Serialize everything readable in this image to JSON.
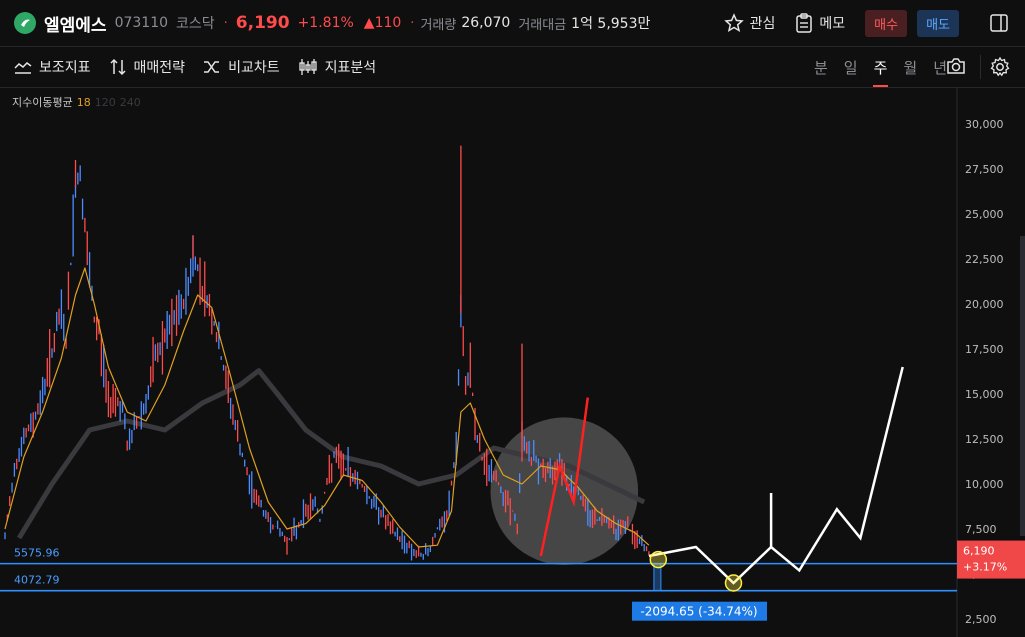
{
  "header": {
    "name": "엘엠에스",
    "code": "073110",
    "market": "코스닥",
    "price": "6,190",
    "change_pct": "+1.81%",
    "change_amt": "▲110",
    "volume_label": "거래량",
    "volume": "26,070",
    "turnover_label": "거래대금",
    "turnover": "1억 5,953만",
    "watch_label": "관심",
    "memo_label": "메모",
    "buy_label": "매수",
    "sell_label": "매도"
  },
  "toolbar": {
    "indicators_label": "보조지표",
    "strategy_label": "매매전략",
    "compare_label": "비교차트",
    "analysis_label": "지표분석",
    "periods": [
      "분",
      "일",
      "주",
      "월",
      "년"
    ],
    "active_period": "주"
  },
  "legend": {
    "title": "지수이동평균",
    "ma1": "18",
    "ma2": "120",
    "ma3": "240"
  },
  "colors": {
    "up": "#ff4b4b",
    "down": "#4b8cff",
    "ma18": "#e0a020",
    "ma_long": "#3a3a3e",
    "level_line": "#2f8fff",
    "projection": "#ffffff",
    "pattern": "#ff2020",
    "marker": "#ffee44"
  },
  "chart_data": {
    "type": "line",
    "y_axis": {
      "ticks": [
        "30,000",
        "27,500",
        "25,000",
        "22,500",
        "20,000",
        "17,500",
        "15,000",
        "12,500",
        "10,000",
        "7,500",
        "5,000",
        "2,500"
      ],
      "tick_values": [
        30000,
        27500,
        25000,
        22500,
        20000,
        17500,
        15000,
        12500,
        10000,
        7500,
        5000,
        2500
      ],
      "ylim": [
        1500,
        32000
      ]
    },
    "x_range": [
      0,
      100
    ],
    "grid": false,
    "price_series": [
      [
        0,
        7000
      ],
      [
        2,
        11000
      ],
      [
        4,
        12500
      ],
      [
        6,
        13500
      ],
      [
        8,
        15000
      ],
      [
        10,
        17500
      ],
      [
        12,
        19500
      ],
      [
        13,
        18000
      ],
      [
        15,
        26500
      ],
      [
        16,
        27300
      ],
      [
        17,
        24000
      ],
      [
        18,
        21500
      ],
      [
        19,
        19000
      ],
      [
        20,
        18500
      ],
      [
        21,
        16500
      ],
      [
        22,
        14500
      ],
      [
        23,
        15000
      ],
      [
        25,
        14200
      ],
      [
        26,
        12000
      ],
      [
        28,
        13500
      ],
      [
        30,
        14500
      ],
      [
        32,
        17000
      ],
      [
        34,
        18000
      ],
      [
        36,
        19000
      ],
      [
        38,
        20000
      ],
      [
        40,
        22500
      ],
      [
        41,
        22000
      ],
      [
        42,
        21000
      ],
      [
        44,
        19500
      ],
      [
        46,
        17000
      ],
      [
        48,
        14500
      ],
      [
        50,
        12000
      ],
      [
        52,
        10000
      ],
      [
        54,
        9000
      ],
      [
        56,
        8000
      ],
      [
        58,
        7500
      ],
      [
        60,
        6800
      ],
      [
        62,
        7500
      ],
      [
        64,
        8500
      ],
      [
        66,
        9000
      ],
      [
        67,
        8000
      ],
      [
        68,
        9500
      ],
      [
        70,
        11500
      ],
      [
        72,
        11000
      ],
      [
        74,
        10500
      ],
      [
        76,
        10000
      ],
      [
        78,
        9000
      ],
      [
        80,
        8500
      ],
      [
        82,
        7500
      ],
      [
        84,
        7000
      ],
      [
        86,
        6500
      ],
      [
        88,
        6000
      ],
      [
        90,
        6200
      ],
      [
        92,
        7500
      ],
      [
        94,
        8000
      ],
      [
        96,
        12000
      ],
      [
        97,
        19500
      ],
      [
        98,
        15000
      ],
      [
        99,
        17000
      ],
      [
        100,
        13000
      ],
      [
        102,
        11000
      ],
      [
        104,
        10500
      ],
      [
        106,
        9500
      ],
      [
        108,
        8500
      ],
      [
        109,
        7500
      ],
      [
        110,
        12500
      ],
      [
        112,
        11500
      ],
      [
        114,
        11000
      ],
      [
        116,
        10500
      ],
      [
        118,
        11500
      ],
      [
        120,
        10000
      ],
      [
        122,
        9500
      ],
      [
        124,
        8500
      ],
      [
        126,
        8000
      ],
      [
        128,
        8200
      ],
      [
        130,
        7500
      ],
      [
        132,
        7800
      ],
      [
        134,
        7000
      ],
      [
        136,
        6500
      ],
      [
        137,
        6190
      ]
    ],
    "ma18_series": [
      [
        0,
        7500
      ],
      [
        4,
        11500
      ],
      [
        8,
        14000
      ],
      [
        12,
        17000
      ],
      [
        15,
        20500
      ],
      [
        17,
        22000
      ],
      [
        19,
        20000
      ],
      [
        22,
        16500
      ],
      [
        26,
        14000
      ],
      [
        30,
        13500
      ],
      [
        34,
        15500
      ],
      [
        38,
        18500
      ],
      [
        41,
        20500
      ],
      [
        44,
        19800
      ],
      [
        48,
        16000
      ],
      [
        52,
        12000
      ],
      [
        56,
        9000
      ],
      [
        60,
        7500
      ],
      [
        64,
        7800
      ],
      [
        68,
        8800
      ],
      [
        72,
        10500
      ],
      [
        76,
        10200
      ],
      [
        80,
        9000
      ],
      [
        84,
        7600
      ],
      [
        88,
        6500
      ],
      [
        92,
        6600
      ],
      [
        95,
        8500
      ],
      [
        97,
        14000
      ],
      [
        99,
        14500
      ],
      [
        102,
        12500
      ],
      [
        106,
        10500
      ],
      [
        110,
        10000
      ],
      [
        114,
        11000
      ],
      [
        118,
        10800
      ],
      [
        122,
        9800
      ],
      [
        126,
        8500
      ],
      [
        130,
        7800
      ],
      [
        134,
        7300
      ],
      [
        137,
        6600
      ]
    ],
    "ma120_series": [
      [
        3,
        7000
      ],
      [
        10,
        10000
      ],
      [
        18,
        13000
      ],
      [
        26,
        13500
      ],
      [
        34,
        13000
      ],
      [
        42,
        14500
      ],
      [
        50,
        15500
      ],
      [
        54,
        16300
      ],
      [
        58,
        15000
      ],
      [
        64,
        13000
      ],
      [
        72,
        11500
      ],
      [
        80,
        11000
      ],
      [
        88,
        10000
      ],
      [
        96,
        10500
      ],
      [
        104,
        12000
      ],
      [
        112,
        11500
      ],
      [
        120,
        11000
      ],
      [
        128,
        10000
      ],
      [
        136,
        9000
      ]
    ],
    "levels": [
      {
        "label": "5575.96",
        "value": 5575.96
      },
      {
        "label": "4072.79",
        "value": 4072.79
      }
    ],
    "measure_label": "-2094.65  (-34.74%)",
    "current_price_label": "6,190",
    "current_change_label": "+3.17%",
    "current_price_value": 6190,
    "projection_series": [
      [
        137,
        6000
      ],
      [
        147,
        6500
      ],
      [
        155,
        4500
      ],
      [
        163,
        6500
      ],
      [
        169,
        5200
      ],
      [
        177,
        8600
      ],
      [
        182,
        7000
      ],
      [
        191,
        16500
      ]
    ],
    "projection_spike": {
      "x": 163,
      "from": 6500,
      "to": 9500
    },
    "pattern_series": [
      [
        114,
        6000
      ],
      [
        118,
        11000
      ],
      [
        121,
        9000
      ],
      [
        124,
        14800
      ]
    ],
    "pattern_circle": {
      "x": 119,
      "y": 9600,
      "r_value": 4100
    },
    "markers": [
      {
        "x": 139,
        "y": 5800
      },
      {
        "x": 155,
        "y": 4500
      }
    ]
  }
}
